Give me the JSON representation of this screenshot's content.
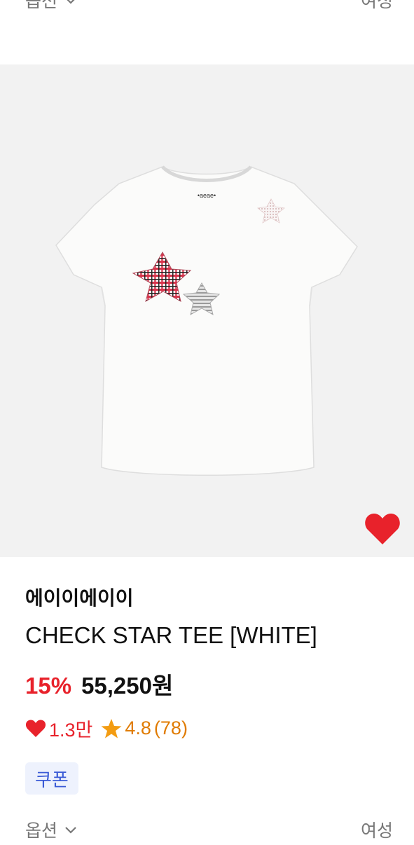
{
  "top_row": {
    "option_label": "옵션",
    "gender_label": "여성"
  },
  "product": {
    "brand": "에이이에이이",
    "title": "CHECK STAR TEE [WHITE]",
    "discount": "15%",
    "price": "55,250원",
    "like_count": "1.3만",
    "rating": "4.8",
    "review_count": "(78)",
    "coupon_label": "쿠폰",
    "liked": true,
    "tee_logo_text": "•aeae•"
  },
  "bottom_row": {
    "option_label": "옵션",
    "gender_label": "여성"
  },
  "colors": {
    "discount": "#e8222b",
    "heart": "#e8222b",
    "star": "#f39c12",
    "coupon_bg": "#eef2fd",
    "coupon_text": "#3b5bd6",
    "image_bg": "#f2f2f2"
  },
  "icons": {
    "like_button": "heart-icon",
    "like_stat": "heart-icon",
    "rating": "star-icon",
    "option_dropdown": "chevron-down-icon"
  }
}
